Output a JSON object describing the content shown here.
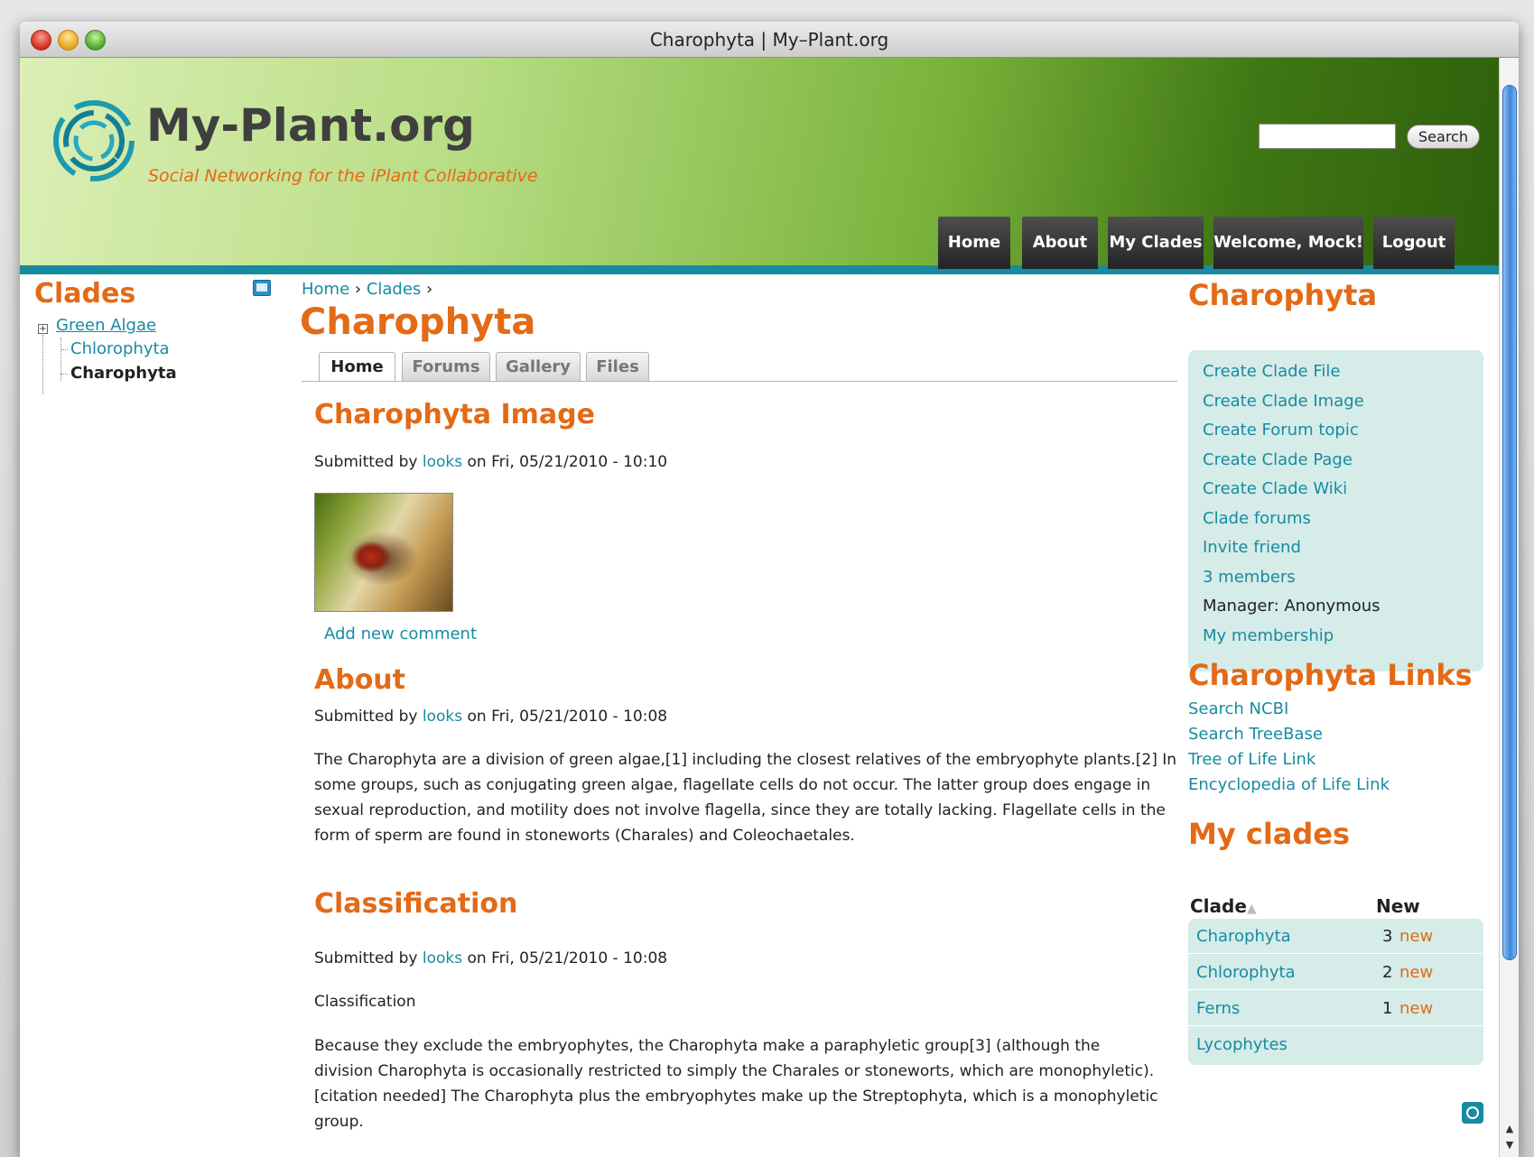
{
  "window": {
    "title": "Charophyta | My–Plant.org"
  },
  "header": {
    "site_name": "My-Plant.org",
    "slogan": "Social Networking for the iPlant Collaborative",
    "search_placeholder": "",
    "search_button": "Search",
    "nav": [
      "Home",
      "About",
      "My Clades",
      "Welcome, Mock!",
      "Logout"
    ]
  },
  "left_sidebar": {
    "title": "Clades",
    "tree": [
      {
        "label": "Green Algae"
      },
      {
        "label": "Chlorophyta"
      },
      {
        "label": "Charophyta"
      }
    ]
  },
  "main": {
    "breadcrumb": [
      "Home",
      "Clades"
    ],
    "title": "Charophyta",
    "tabs": [
      "Home",
      "Forums",
      "Gallery",
      "Files"
    ],
    "sections": [
      {
        "heading": "Charophyta Image",
        "submitted_prefix": "Submitted by",
        "author": "looks",
        "date": "on Fri, 05/21/2010 - 10:10",
        "comment_link": "Add new comment"
      },
      {
        "heading": "About",
        "submitted_prefix": "Submitted by",
        "author": "looks",
        "date": "on Fri, 05/21/2010 - 10:08",
        "body": "The Charophyta are a division of green algae,[1] including the closest relatives of the embryophyte plants.[2] In some groups, such as conjugating green algae, flagellate cells do not occur. The latter group does engage in sexual reproduction, and motility does not involve flagella, since they are totally lacking. Flagellate cells in the form of sperm are found in stoneworts (Charales) and Coleochaetales."
      },
      {
        "heading": "Classification",
        "submitted_prefix": "Submitted by",
        "author": "looks",
        "date": "on Fri, 05/21/2010 - 10:08",
        "body1": "Classification",
        "body2": "Because they exclude the embryophytes, the Charophyta make a paraphyletic group[3] (although the division Charophyta is occasionally restricted to simply the Charales or stoneworts, which are monophyletic).[citation needed] The Charophyta plus the embryophytes make up the Streptophyta, which is a monophyletic group."
      }
    ]
  },
  "right_sidebar": {
    "clade_block_title": "Charophyta",
    "clade_links": [
      "Create Clade File",
      "Create Clade Image",
      "Create Forum topic",
      "Create Clade Page",
      "Create Clade Wiki",
      "Clade forums",
      "Invite friend",
      "3 members"
    ],
    "manager": "Manager: Anonymous",
    "membership": "My membership",
    "links_title": "Charophyta Links",
    "links": [
      "Search NCBI",
      "Search TreeBase",
      "Tree of Life Link",
      "Encyclopedia of Life Link"
    ],
    "my_clades_title": "My clades",
    "my_clades_headers": {
      "clade": "Clade",
      "new": "New"
    },
    "my_clades_rows": [
      {
        "clade": "Charophyta",
        "count": "3",
        "new": "new"
      },
      {
        "clade": "Chlorophyta",
        "count": "2",
        "new": "new"
      },
      {
        "clade": "Ferns",
        "count": "1",
        "new": "new"
      },
      {
        "clade": "Lycophytes",
        "count": "",
        "new": ""
      }
    ]
  }
}
